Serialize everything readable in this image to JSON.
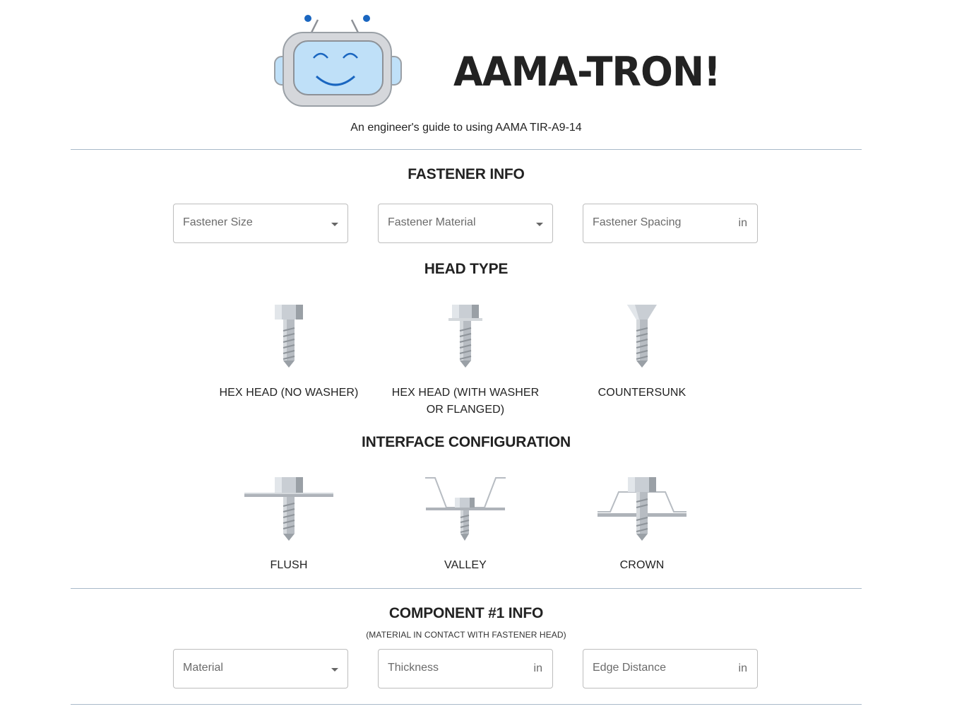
{
  "header": {
    "app_title": "AAMA-TRON!",
    "subtitle": "An engineer's guide to using AAMA TIR-A9-14"
  },
  "fastener_info": {
    "title": "FASTENER INFO",
    "fields": {
      "size": {
        "label": "Fastener Size"
      },
      "material": {
        "label": "Fastener Material"
      },
      "spacing": {
        "label": "Fastener Spacing",
        "unit": "in"
      }
    }
  },
  "head_type": {
    "title": "HEAD TYPE",
    "options": [
      {
        "label": "HEX HEAD (NO WASHER)",
        "icon": "hex-head-screw-icon"
      },
      {
        "label": "HEX HEAD (WITH WASHER OR FLANGED)",
        "icon": "hex-head-washer-screw-icon"
      },
      {
        "label": "COUNTERSUNK",
        "icon": "countersunk-screw-icon"
      }
    ]
  },
  "interface_configuration": {
    "title": "INTERFACE CONFIGURATION",
    "options": [
      {
        "label": "FLUSH",
        "icon": "flush-interface-icon"
      },
      {
        "label": "VALLEY",
        "icon": "valley-interface-icon"
      },
      {
        "label": "CROWN",
        "icon": "crown-interface-icon"
      }
    ]
  },
  "component_1": {
    "title": "COMPONENT #1 INFO",
    "note": "(MATERIAL IN CONTACT WITH FASTENER HEAD)",
    "fields": {
      "material": {
        "label": "Material"
      },
      "thickness": {
        "label": "Thickness",
        "unit": "in"
      },
      "edge_distance": {
        "label": "Edge Distance",
        "unit": "in"
      }
    }
  },
  "colors": {
    "robot_face": "#bfe0f8",
    "robot_body": "#d5d7db",
    "robot_accent": "#1a66c0",
    "screw_light": "#c9ced4",
    "screw_dark": "#9aa0a6",
    "divider": "#a9b9c9"
  }
}
